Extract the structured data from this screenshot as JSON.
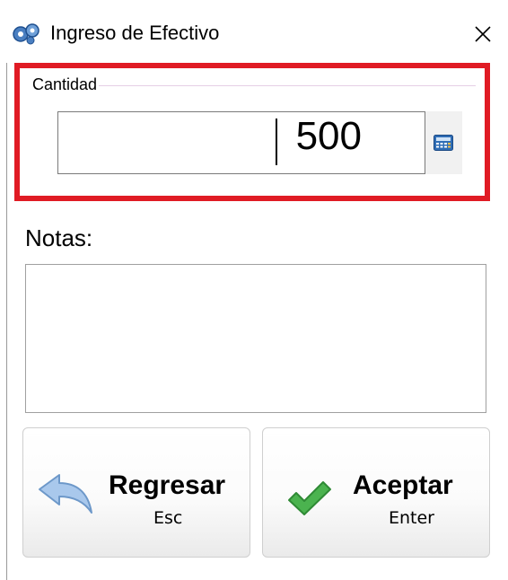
{
  "window": {
    "title": "Ingreso de Efectivo",
    "app_icon": "gears-icon",
    "close_icon": "close-icon"
  },
  "cantidad": {
    "group_label": "Cantidad",
    "value": "500",
    "calculator_icon": "calculator-icon"
  },
  "notas": {
    "label": "Notas:",
    "value": ""
  },
  "buttons": {
    "back": {
      "label": "Regresar",
      "shortcut": "Esc",
      "icon": "back-arrow-icon"
    },
    "accept": {
      "label": "Aceptar",
      "shortcut": "Enter",
      "icon": "checkmark-icon"
    }
  },
  "colors": {
    "highlight": "#e01b24",
    "check_green": "#3aa64a",
    "arrow_blue": "#8fb6e0"
  }
}
